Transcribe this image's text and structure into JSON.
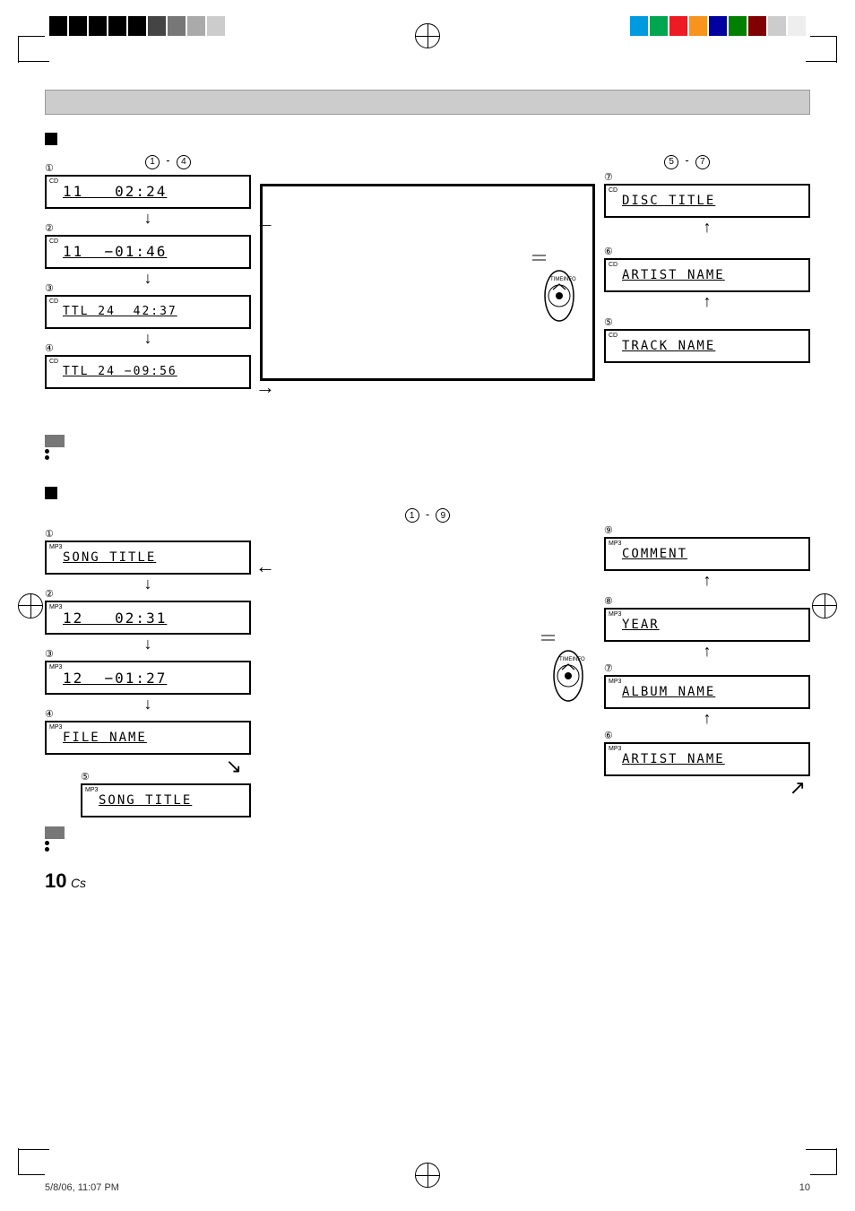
{
  "page": {
    "number": "10",
    "suffix": "Cs",
    "date": "5/8/06, 11:07 PM",
    "page_label": "10"
  },
  "top_bar": {
    "left_bars": [
      "#000",
      "#000",
      "#000",
      "#000",
      "#000",
      "#222",
      "#444",
      "#666",
      "#888"
    ],
    "right_bars": [
      "#009",
      "#0a0",
      "#a00",
      "#770",
      "#007",
      "#070",
      "#700",
      "#ccc",
      "#eee"
    ]
  },
  "cd_section": {
    "title": "■",
    "range_left": "① - ④",
    "range_right": "⑤ - ⑦",
    "items_left": [
      {
        "num": "①",
        "badge": "CD",
        "display": "11   02:24",
        "arrow": "↓"
      },
      {
        "num": "②",
        "badge": "CD",
        "display": "11  −01:46",
        "arrow": "↓"
      },
      {
        "num": "③",
        "badge": "CD",
        "display": "TTL 24   42:37",
        "arrow": "↓"
      },
      {
        "num": "④",
        "badge": "CD",
        "display": "TTL 24  −09:56",
        "arrow": ""
      }
    ],
    "items_right": [
      {
        "num": "⑦",
        "badge": "CD",
        "display": "DISC TITLE",
        "arrow": "↑"
      },
      {
        "num": "⑥",
        "badge": "CD",
        "display": "ARTIST NAME",
        "arrow": "↑"
      },
      {
        "num": "⑤",
        "badge": "CD",
        "display": "TRACK NAME",
        "arrow": ""
      }
    ]
  },
  "mp3_section": {
    "title": "■",
    "range": "① - ⑨",
    "items_left": [
      {
        "num": "①",
        "badge": "MP3",
        "display": "SONG TITLE",
        "arrow": "↓"
      },
      {
        "num": "②",
        "badge": "MP3",
        "display": "12   02:31",
        "arrow": "↓"
      },
      {
        "num": "③",
        "badge": "MP3",
        "display": "12  −01:27",
        "arrow": "↓"
      },
      {
        "num": "④",
        "badge": "MP3",
        "display": "FILE NAME",
        "arrow": "↘"
      },
      {
        "num": "⑤",
        "badge": "MP3",
        "display": "SONG TITLE",
        "arrow": ""
      }
    ],
    "items_right": [
      {
        "num": "⑨",
        "badge": "MP3",
        "display": "COMMENT",
        "arrow": "↑"
      },
      {
        "num": "⑧",
        "badge": "MP3",
        "display": "YEAR",
        "arrow": "↑"
      },
      {
        "num": "⑦",
        "badge": "MP3",
        "display": "ALBUM NAME",
        "arrow": "↑"
      },
      {
        "num": "⑥",
        "badge": "MP3",
        "display": "ARTIST NAME",
        "arrow": "↗"
      }
    ]
  },
  "notes": {
    "cd_bullets": [
      "",
      ""
    ],
    "mp3_bullets": [
      "",
      ""
    ]
  }
}
